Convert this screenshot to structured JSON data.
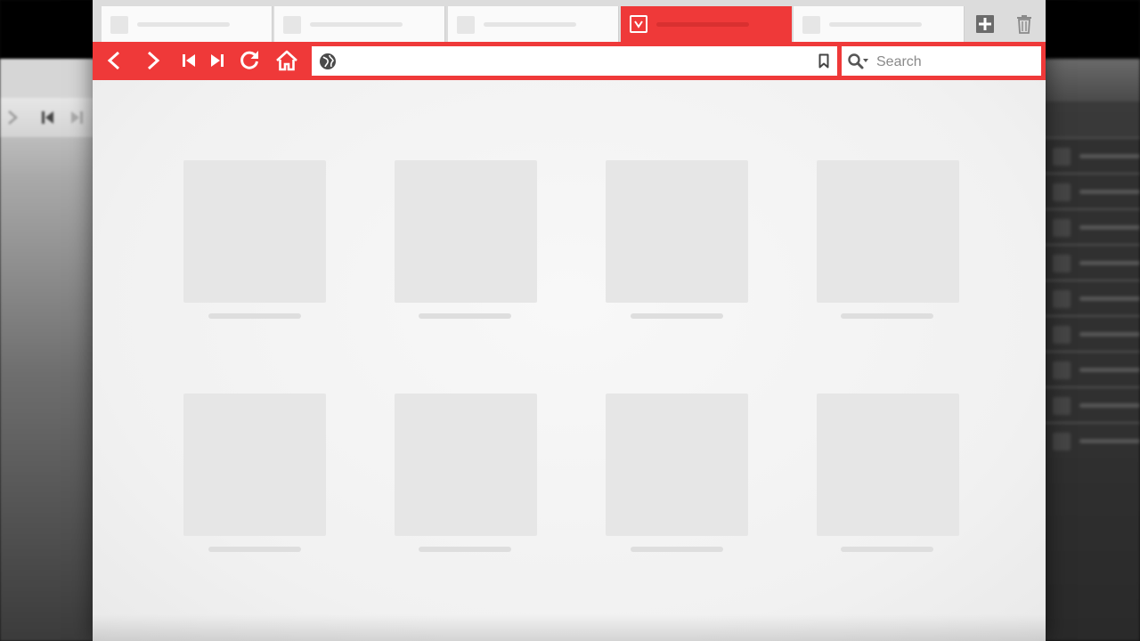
{
  "tabs": [
    {
      "id": "tab-1",
      "active": false
    },
    {
      "id": "tab-2",
      "active": false
    },
    {
      "id": "tab-3",
      "active": false
    },
    {
      "id": "tab-4",
      "active": true
    },
    {
      "id": "tab-5",
      "active": false
    }
  ],
  "address_bar": {
    "value": ""
  },
  "search": {
    "placeholder": "Search"
  },
  "colors": {
    "accent": "#ef3939",
    "tabbar_bg": "#dcdcdc",
    "content_bg": "#f3f3f3",
    "tile": "#e6e6e6"
  },
  "icons": {
    "back": "chevron-left-icon",
    "forward": "chevron-right-icon",
    "rewind": "skip-back-icon",
    "fastforward": "skip-forward-icon",
    "reload": "reload-icon",
    "home": "home-icon",
    "site_info": "globe-icon",
    "bookmark": "bookmark-icon",
    "search_engine": "search-icon",
    "new_tab": "plus-icon",
    "trash": "trash-icon"
  },
  "speed_dial": {
    "tile_count": 8
  }
}
